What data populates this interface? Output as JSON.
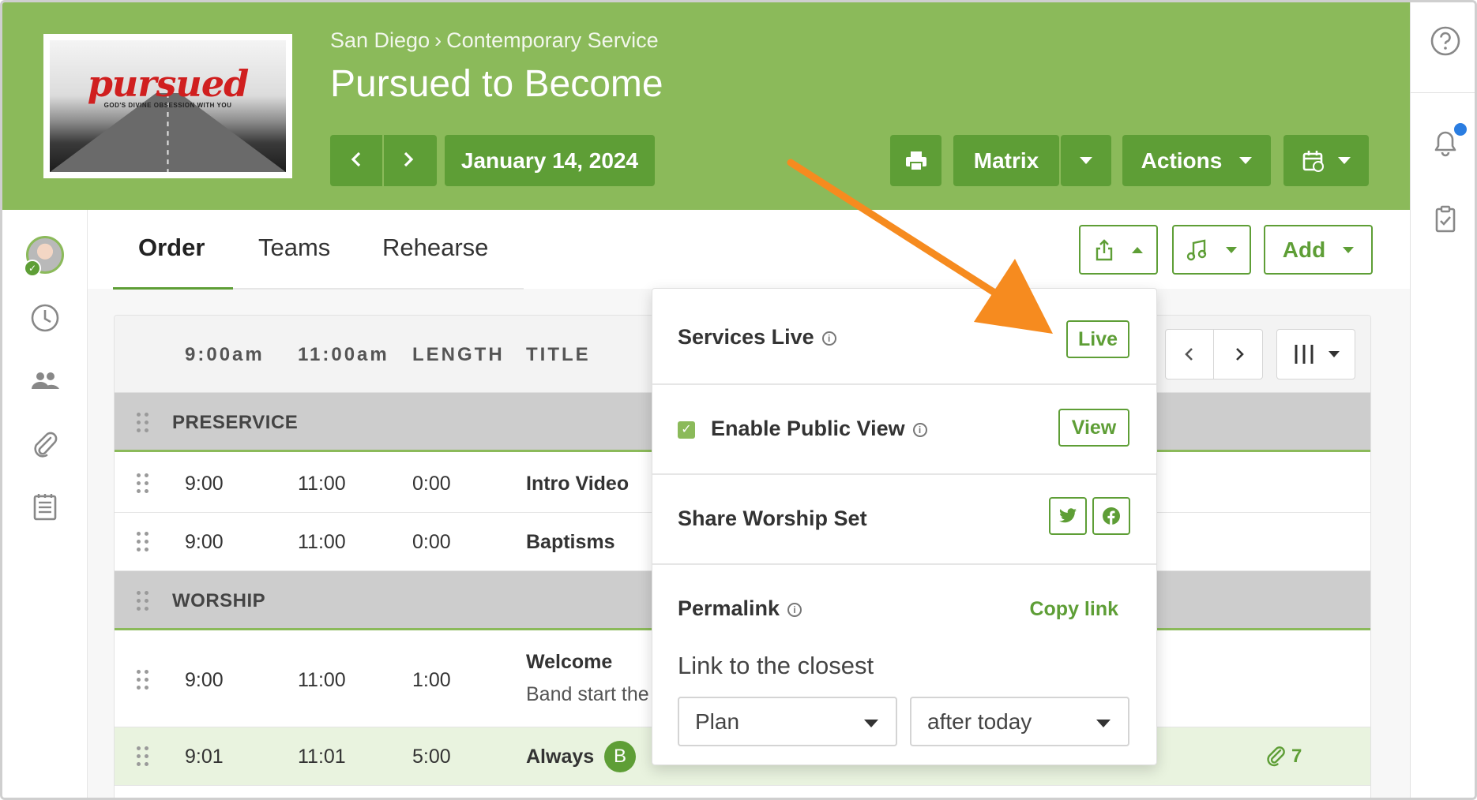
{
  "header": {
    "thumbnail_title": "pursued",
    "thumbnail_subtitle": "GOD'S DIVINE OBSESSION WITH YOU",
    "breadcrumb_location": "San Diego",
    "breadcrumb_service": "Contemporary Service",
    "plan_title": "Pursued to Become",
    "date_label": "January 14, 2024",
    "matrix_label": "Matrix",
    "actions_label": "Actions"
  },
  "tabs": [
    {
      "label": "Order"
    },
    {
      "label": "Teams"
    },
    {
      "label": "Rehearse"
    }
  ],
  "toolbar": {
    "add_label": "Add"
  },
  "table": {
    "headers": [
      "9:00am",
      "11:00am",
      "LENGTH",
      "TITLE"
    ],
    "sections": [
      {
        "label": "PRESERVICE"
      },
      {
        "label": "WORSHIP"
      }
    ],
    "rows": [
      {
        "t1": "9:00",
        "t2": "11:00",
        "length": "0:00",
        "title": "Intro Video"
      },
      {
        "t1": "9:00",
        "t2": "11:00",
        "length": "0:00",
        "title": "Baptisms"
      },
      {
        "t1": "9:00",
        "t2": "11:00",
        "length": "1:00",
        "title": "Welcome",
        "note": "Band start the"
      },
      {
        "t1": "9:01",
        "t2": "11:01",
        "length": "5:00",
        "title": "Always",
        "badge": "B",
        "attachments": "7"
      }
    ]
  },
  "popover": {
    "services_live_label": "Services Live",
    "live_button": "Live",
    "enable_public_view_label": "Enable Public View",
    "public_view_checked": true,
    "view_button": "View",
    "share_label": "Share Worship Set",
    "permalink_label": "Permalink",
    "copy_link_label": "Copy link",
    "link_closest_label": "Link to the closest",
    "link_type_value": "Plan",
    "link_when_value": "after today"
  },
  "colors": {
    "header_green": "#8bba5a",
    "button_green": "#5e9e36",
    "annotation_arrow": "#f68b1f",
    "notification_dot": "#2a7de1"
  }
}
